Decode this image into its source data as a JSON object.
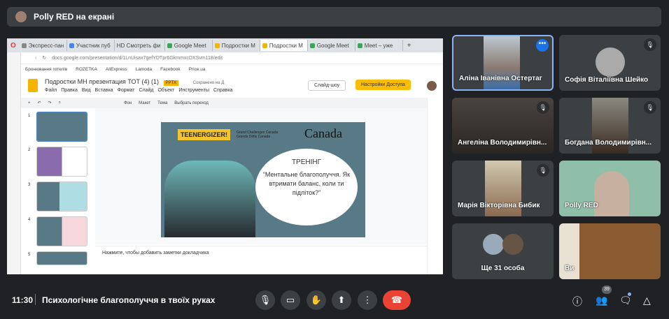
{
  "presenter_bar": {
    "label": "Polly RED на екрані"
  },
  "browser": {
    "tabs": [
      "Экспресс-пан",
      "Участник пуб",
      "HD Смотреть фи",
      "Google Meet",
      "Подростки М",
      "Подростки М",
      "Google Meet",
      "Meet – уже"
    ],
    "active_tab": 5,
    "url": "docs.google.com/presentation/d/1LnUisax7gefYDTpr6GkmmxcDXSvm118/edit",
    "bookmarks": [
      "Бронювання готелів",
      "ROZETKA",
      "AliExpress",
      "Lamoda",
      "Facebook",
      "Price.ua"
    ]
  },
  "slides_doc": {
    "title": "Подростки МН презентация ТОТ (4) (1)",
    "badge": "PPTX",
    "save_status": "Сохранено на Д",
    "menu": [
      "Файл",
      "Правка",
      "Вид",
      "Вставка",
      "Формат",
      "Слайд",
      "Объект",
      "Инструменты",
      "Справка"
    ],
    "slideshow_label": "Слайд-шоу",
    "share_label": "Настройки Доступа",
    "toolbar": [
      "Фон",
      "Макет",
      "Тема",
      "Выбрать переход"
    ],
    "slide_numbers": [
      "1",
      "2",
      "3",
      "4",
      "5"
    ],
    "slide": {
      "logo1": "TEENERGIZER!",
      "logo2_line1": "Grand Challenges Canada",
      "logo2_line2": "Grands Défis Canada",
      "logo3": "Canada",
      "heading": "ТРЕНІНГ",
      "quote": "“Ментальне благополуччя. Як втримати баланс, коли ти підліток?”"
    },
    "notes_placeholder": "Нажмите, чтобы добавить заметки докладчика"
  },
  "participants": [
    {
      "name": "Аліна Іванівна Остертаг",
      "active": true
    },
    {
      "name": "Софія Віталіївна Шейко",
      "muted": true
    },
    {
      "name": "Ангеліна Володимирівн...",
      "muted": true
    },
    {
      "name": "Богдана Володимирівн...",
      "muted": true
    },
    {
      "name": "Марія Вікторівна Бибик",
      "muted": true
    },
    {
      "name": "Polly RED"
    },
    {
      "name": "Ще 31 особа"
    },
    {
      "name": "Ви"
    }
  ],
  "bottom": {
    "time": "11:30",
    "meeting_title": "Психологічне благополуччя в твоїх руках",
    "people_count": "39"
  },
  "colors": {
    "background": "#202124",
    "tile": "#3c4043",
    "end_call": "#ea4335",
    "accent": "#8ab4f8"
  }
}
